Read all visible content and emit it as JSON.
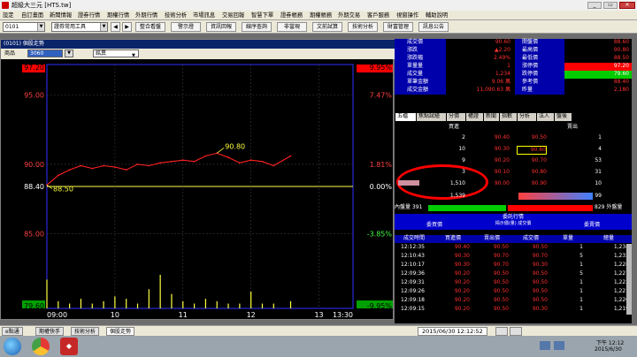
{
  "app": {
    "title": "超級大三元 [HTS.tw]"
  },
  "menu": [
    "設定",
    "自訂畫面",
    "新聞情報",
    "證券行情",
    "期權行情",
    "外期行情",
    "技術分析",
    "市場訊息",
    "交易回報",
    "智慧下單",
    "證券帳務",
    "期權帳務",
    "外期交易",
    "客戶服務",
    "視窗操作",
    "輔助說明"
  ],
  "toolbar": {
    "code_value": "0101",
    "tool_combo": "證券常用工具",
    "buttons": [
      "整合看盤",
      "警示燈",
      "資訊回報",
      "線序查詢",
      "非當現",
      "文前試算",
      "技術分析",
      "財富管理",
      "訊息公告"
    ]
  },
  "chart": {
    "window_title": "(0101) 個股走勢",
    "product_label": "商品",
    "product_value": "3060",
    "tool_value": "銘異",
    "y_left": [
      "97.20",
      "95.00",
      "90.00",
      "88.40",
      "85.00",
      "79.60"
    ],
    "y_right": [
      "9.95%",
      "7.47%",
      "1.81%",
      "0.00%",
      "-3.85%",
      "-9.95%"
    ],
    "x_labels": [
      "09:00",
      "10",
      "11",
      "12",
      "13",
      "13:30"
    ],
    "annotation_high": "90.80",
    "annotation_low": "88.50",
    "colors": {
      "up": "#ff2020",
      "down": "#00c000",
      "ref": "#ffff40",
      "grid": "#3a3a3a",
      "axis_left": "#ff4040",
      "axis_right_up": "#ff4040",
      "axis_right_down": "#40ff40"
    }
  },
  "chart_data": {
    "type": "line",
    "title": "",
    "ylim": [
      79.6,
      97.2
    ],
    "reference": 88.4,
    "x": [
      "09:00",
      "09:10",
      "09:20",
      "09:30",
      "09:40",
      "09:50",
      "10:00",
      "10:10",
      "10:20",
      "10:30",
      "10:40",
      "10:50",
      "11:00",
      "11:10",
      "11:20",
      "11:30",
      "11:40",
      "11:50",
      "12:00",
      "12:10",
      "12:20",
      "12:35"
    ],
    "series": [
      {
        "values": [
          88.5,
          89.2,
          89.6,
          89.9,
          89.7,
          89.9,
          89.8,
          89.6,
          90.0,
          89.9,
          90.1,
          90.2,
          90.3,
          90.2,
          90.6,
          90.8,
          90.5,
          90.1,
          90.3,
          90.2,
          89.9,
          90.6
        ]
      }
    ],
    "volume": [
      12,
      3,
      2,
      4,
      2,
      3,
      5,
      4,
      2,
      8,
      14,
      6,
      3,
      2,
      4,
      3,
      2,
      2,
      7,
      2,
      2,
      3
    ]
  },
  "quote": {
    "left_labels": [
      "成交價",
      "漲跌",
      "漲跌幅",
      "單量量",
      "成交量",
      "單筆金額",
      "成交金額"
    ],
    "left_values": [
      "90.60",
      "▲2.20",
      "2.49%",
      "1",
      "1,234",
      "9.06 萬",
      "11,090.63 萬"
    ],
    "right_labels": [
      "開盤價",
      "最高價",
      "最低價",
      "漲停價",
      "跌停價",
      "參考價",
      "昨量"
    ],
    "right_values": [
      "88.60",
      "90.80",
      "88.50",
      "97.20",
      "79.60",
      "88.40",
      "2,180"
    ],
    "tabs": [
      "五檔",
      "焦點試繪",
      "分價",
      "權證",
      "新聞",
      "指數",
      "分析",
      "法人",
      "盤後"
    ],
    "book_header_buy": "買進",
    "book_header_sell": "賣出",
    "book": [
      {
        "bid_qty": "2",
        "bid": "90.40",
        "ask": "90.50",
        "ask_qty": "1"
      },
      {
        "bid_qty": "10",
        "bid": "90.30",
        "ask": "90.60",
        "ask_qty": "4"
      },
      {
        "bid_qty": "9",
        "bid": "90.20",
        "ask": "90.70",
        "ask_qty": "53"
      },
      {
        "bid_qty": "3",
        "bid": "90.10",
        "ask": "90.80",
        "ask_qty": "31"
      },
      {
        "bid_qty": "1,510",
        "bid": "90.00",
        "ask": "90.90",
        "ask_qty": "10"
      }
    ],
    "book_total_bid": "1,539",
    "book_total_ask": "99",
    "inner_label": "內盤量 391",
    "outer_label": "829 外盤量",
    "section_header": "委託行情",
    "col_bid": "委買價",
    "col_trade_head": "成交價",
    "col_trade_sub": "揭示價(量)",
    "col_ask": "委賣價",
    "trade_cols": [
      "成交時間",
      "買進價",
      "賣出價",
      "成交價",
      "單量",
      "總量"
    ],
    "trades": [
      [
        "12:12:35",
        "90.40",
        "90.50",
        "90.50",
        "1",
        "1,234"
      ],
      [
        "12:10:43",
        "90.30",
        "90.70",
        "90.70",
        "5",
        "1,233"
      ],
      [
        "12:10:17",
        "90.30",
        "90.70",
        "90.30",
        "1",
        "1,228"
      ],
      [
        "12:09:36",
        "90.20",
        "90.50",
        "90.50",
        "5",
        "1,227"
      ],
      [
        "12:09:31",
        "90.20",
        "90.50",
        "90.50",
        "1",
        "1,222"
      ],
      [
        "12:09:26",
        "90.20",
        "90.50",
        "90.50",
        "1",
        "1,221"
      ],
      [
        "12:09:18",
        "90.20",
        "90.50",
        "90.50",
        "1",
        "1,220"
      ],
      [
        "12:09:15",
        "90.20",
        "90.50",
        "90.30",
        "1",
        "1,219"
      ]
    ]
  },
  "status": {
    "tabs": [
      "e點通",
      "期權快手",
      "技術分析",
      "個股走勢"
    ],
    "datetime": "2015/06/30 12:12:52"
  },
  "taskbar": {
    "clock_time": "下午 12:12",
    "clock_date": "2015/6/30"
  }
}
